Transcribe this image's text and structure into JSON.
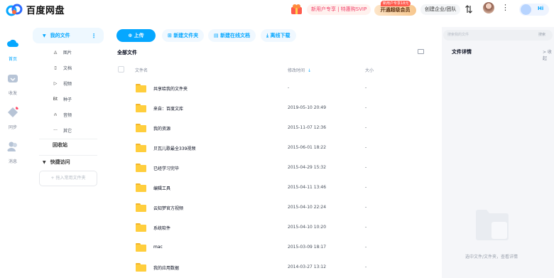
{
  "app": {
    "title": "百度网盘"
  },
  "topbar": {
    "promo_text": "新用户专享 | 特惠购SVIP",
    "vip_tag": "新用户专享18元",
    "vip_button": "开通超级会员",
    "enterprise_button": "创建企业/团队",
    "more": "⋮",
    "hi_label": "Hi"
  },
  "leftnav": {
    "items": [
      {
        "label": "首页",
        "icon": "cloud-home-icon"
      },
      {
        "label": "收发",
        "icon": "inbox-icon"
      },
      {
        "label": "同步",
        "icon": "sync-icon"
      },
      {
        "label": "消息",
        "icon": "contacts-icon"
      }
    ]
  },
  "sidebar": {
    "my_files": "我的文件",
    "sub": [
      {
        "icon": "◬",
        "label": "图片"
      },
      {
        "icon": "▯",
        "label": "文档"
      },
      {
        "icon": "▷",
        "label": "视频"
      },
      {
        "icon": "Bt",
        "label": "种子"
      },
      {
        "icon": "∩",
        "label": "音频"
      },
      {
        "icon": "···",
        "label": "其它"
      }
    ],
    "recycle": "回收站",
    "quick_access": "快捷访问",
    "drag_hint": "+ 拖入常用文件夹"
  },
  "toolbar": {
    "upload": "上传",
    "new_folder": "新建文件夹",
    "new_online_doc": "新建在线文档",
    "offline_download": "离线下载"
  },
  "main": {
    "breadcrumb": "全部文件",
    "columns": {
      "name": "文件名",
      "modified": "修改时间",
      "size": "大小"
    },
    "rows": [
      {
        "name": "共享给我的文件夹",
        "modified": "-",
        "size": "-"
      },
      {
        "name": "来自：百度文库",
        "modified": "2019-05-10 20:49",
        "size": "-"
      },
      {
        "name": "我的资源",
        "modified": "2015-11-07 12:36",
        "size": "-"
      },
      {
        "name": "贝瓦儿歌最全339视频",
        "modified": "2015-06-01 18:22",
        "size": "-"
      },
      {
        "name": "已经学习完毕",
        "modified": "2015-04-29 15:32",
        "size": "-"
      },
      {
        "name": "编辑工具",
        "modified": "2015-04-11 13:46",
        "size": "-"
      },
      {
        "name": "云知梦官方视频",
        "modified": "2015-04-10 22:24",
        "size": "-"
      },
      {
        "name": "系统软件",
        "modified": "2015-04-10 10:20",
        "size": "-"
      },
      {
        "name": "mac",
        "modified": "2015-03-09 18:17",
        "size": "-"
      },
      {
        "name": "我的应用数据",
        "modified": "2014-03-27 13:12",
        "size": "-"
      }
    ]
  },
  "right": {
    "search_placeholder": "搜索我的文件",
    "search_button": "搜索",
    "detail_title": "文件详情",
    "collapse": "> 收起",
    "empty_text": "选中文件/文件夹，查看详情"
  },
  "colors": {
    "accent": "#06a7ff",
    "folder": "#ffce3d"
  }
}
